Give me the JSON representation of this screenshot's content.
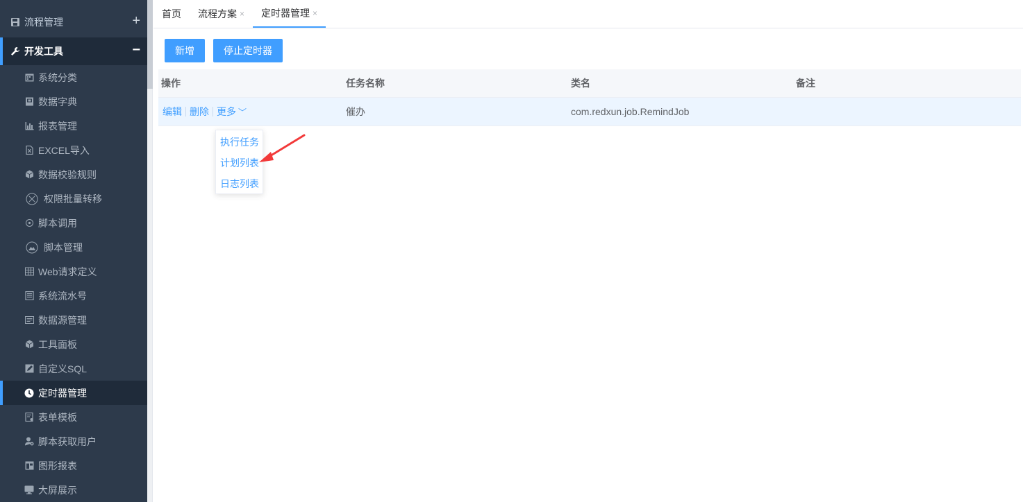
{
  "sidebar": {
    "groups": [
      {
        "label": "流程管理",
        "toggle": "+"
      },
      {
        "label": "开发工具",
        "toggle": "−"
      }
    ],
    "items": [
      {
        "label": "系统分类",
        "icon": "calendar-icon"
      },
      {
        "label": "数据字典",
        "icon": "book-icon"
      },
      {
        "label": "报表管理",
        "icon": "bar-chart-icon"
      },
      {
        "label": "EXCEL导入",
        "icon": "excel-file-icon"
      },
      {
        "label": "数据校验规则",
        "icon": "cube-icon"
      },
      {
        "label": "权限批量转移",
        "icon": "transfer-icon"
      },
      {
        "label": "脚本调用",
        "icon": "circle-dot-icon"
      },
      {
        "label": "脚本管理",
        "icon": "mountain-icon"
      },
      {
        "label": "Web请求定义",
        "icon": "grid-table-icon"
      },
      {
        "label": "系统流水号",
        "icon": "list-document-icon"
      },
      {
        "label": "数据源管理",
        "icon": "id-card-icon"
      },
      {
        "label": "工具面板",
        "icon": "cube-icon"
      },
      {
        "label": "自定义SQL",
        "icon": "edit-square-icon"
      },
      {
        "label": "定时器管理",
        "icon": "clock-icon"
      },
      {
        "label": "表单模板",
        "icon": "form-file-icon"
      },
      {
        "label": "脚本获取用户",
        "icon": "user-gear-icon"
      },
      {
        "label": "图形报表",
        "icon": "chart-board-icon"
      },
      {
        "label": "大屏展示",
        "icon": "monitor-icon"
      }
    ]
  },
  "tabs": [
    {
      "label": "首页",
      "close": ""
    },
    {
      "label": "流程方案",
      "close": "×"
    },
    {
      "label": "定时器管理",
      "close": "×"
    }
  ],
  "toolbar": {
    "add_label": "新增",
    "stop_label": "停止定时器"
  },
  "table": {
    "headers": [
      "操作",
      "任务名称",
      "类名",
      "备注"
    ],
    "rows": [
      {
        "ops": [
          "编辑",
          "删除",
          "更多"
        ],
        "name": "催办",
        "class_name": "com.redxun.job.RemindJob",
        "remark": ""
      }
    ]
  },
  "dropdown": {
    "items": [
      "执行任务",
      "计划列表",
      "日志列表"
    ]
  },
  "colors": {
    "accent": "#409eff",
    "sidebar": "#2d3a4b",
    "arrow": "#f23a3a"
  }
}
